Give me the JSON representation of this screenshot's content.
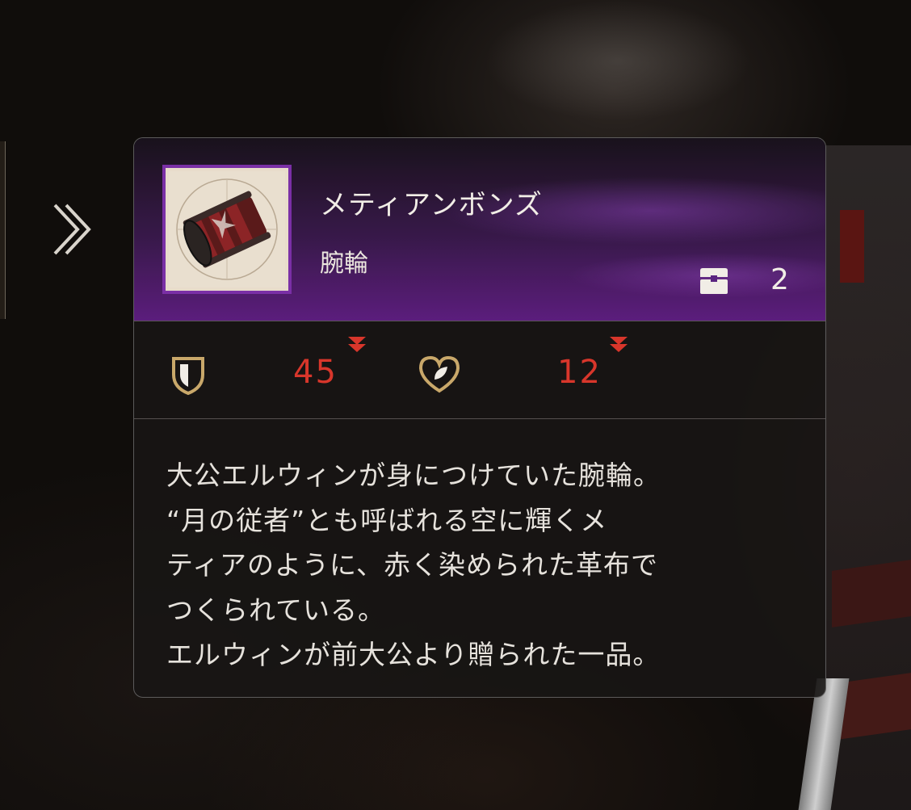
{
  "item": {
    "name": "メティアンボンズ",
    "type": "腕輪",
    "owned_count": "2"
  },
  "stats": {
    "defense": {
      "value": "45",
      "change": "down"
    },
    "hp": {
      "value": "12",
      "change": "down"
    }
  },
  "description": [
    "大公エルウィンが身につけていた腕輪。",
    "“月の従者”とも呼ばれる空に輝くメ",
    "ティアのように、赤く染められた革布で",
    "つくられている。",
    "エルウィンが前大公より贈られた一品。"
  ],
  "icons": {
    "nav": "double-chevron-right-icon",
    "owned": "chest-icon",
    "defense": "shield-icon",
    "hp": "heart-icon",
    "stat_change": "down-arrow-icon"
  },
  "colors": {
    "accent_purple": "#7a2fa6",
    "stat_down_red": "#d8362b",
    "icon_gold": "#c9a86a"
  }
}
